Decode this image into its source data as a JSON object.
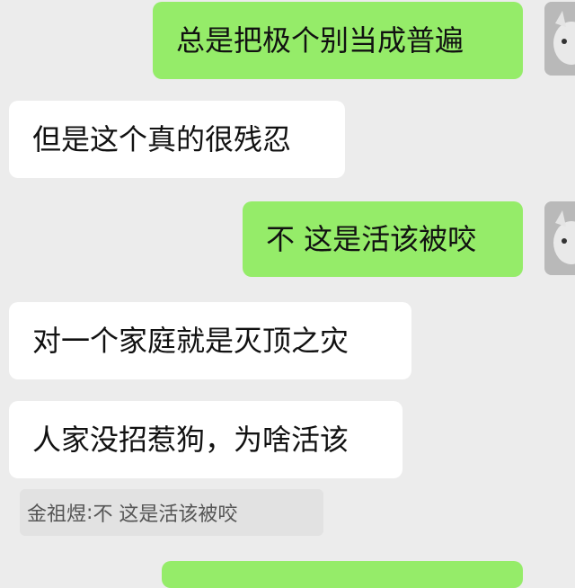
{
  "messages": [
    {
      "side": "sent",
      "text": "总是把极个别当成普遍"
    },
    {
      "side": "received",
      "text": "但是这个真的很残忍"
    },
    {
      "side": "sent",
      "text": "不 这是活该被咬"
    },
    {
      "side": "received",
      "text": "对一个家庭就是灭顶之灾"
    },
    {
      "side": "received",
      "text": "人家没招惹狗，为啥活该"
    }
  ],
  "quote": {
    "author": "金祖煜",
    "separator": ": ",
    "text": "不 这是活该被咬"
  },
  "avatar_icon": "cat-avatar-icon",
  "colors": {
    "sent_bubble": "#95ec69",
    "received_bubble": "#ffffff",
    "background": "#ececec"
  }
}
